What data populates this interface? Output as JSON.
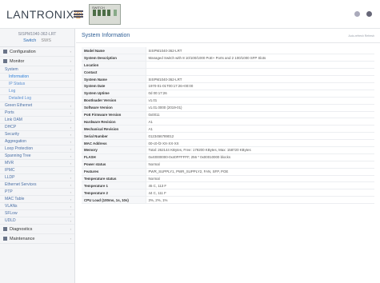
{
  "header": {
    "logo_text": "LANTRONIX",
    "logo_mark": "®",
    "switch_label": "SWITCH"
  },
  "sidebar": {
    "device_name": "SISPM1040-362-LRT",
    "save_label": "Switch",
    "save_extra": "SWS",
    "items": [
      {
        "label": "Configuration",
        "level": "top"
      },
      {
        "label": "Monitor",
        "level": "top"
      },
      {
        "label": "System",
        "level": "sub"
      },
      {
        "label": "Information",
        "level": "sub2",
        "active": true
      },
      {
        "label": "IP Status",
        "level": "sub2"
      },
      {
        "label": "Log",
        "level": "sub2"
      },
      {
        "label": "Detailed Log",
        "level": "sub2"
      },
      {
        "label": "Green Ethernet",
        "level": "sub"
      },
      {
        "label": "Ports",
        "level": "sub"
      },
      {
        "label": "Link OAM",
        "level": "sub"
      },
      {
        "label": "DHCP",
        "level": "sub"
      },
      {
        "label": "Security",
        "level": "sub"
      },
      {
        "label": "Aggregation",
        "level": "sub"
      },
      {
        "label": "Loop Protection",
        "level": "sub"
      },
      {
        "label": "Spanning Tree",
        "level": "sub"
      },
      {
        "label": "MVR",
        "level": "sub"
      },
      {
        "label": "IPMC",
        "level": "sub"
      },
      {
        "label": "LLDP",
        "level": "sub"
      },
      {
        "label": "Ethernet Services",
        "level": "sub"
      },
      {
        "label": "PTP",
        "level": "sub"
      },
      {
        "label": "MAC Table",
        "level": "sub"
      },
      {
        "label": "VLANs",
        "level": "sub"
      },
      {
        "label": "SFLow",
        "level": "sub"
      },
      {
        "label": "UDLD",
        "level": "sub"
      },
      {
        "label": "Diagnostics",
        "level": "top"
      },
      {
        "label": "Maintenance",
        "level": "top"
      }
    ]
  },
  "main": {
    "title": "System Information",
    "breadcrumb": "Auto-refresh  Refresh"
  },
  "info_rows": [
    {
      "key": "Model Name",
      "value": "SISPM1040-362-LRT"
    },
    {
      "key": "System Description",
      "value": "Managed Switch with 8 10/100/1000 PoE+ Ports and 2 100/1000 SFP Slots"
    },
    {
      "key": "Location",
      "value": ""
    },
    {
      "key": "Contact",
      "value": ""
    },
    {
      "key": "System Name",
      "value": "SISPM1040-362-LRT"
    },
    {
      "key": "System Date",
      "value": "1970-01-01T00:17:26+00:00"
    },
    {
      "key": "System Uptime",
      "value": "0d 00:17:26"
    },
    {
      "key": "Bootloader Version",
      "value": "v1.01"
    },
    {
      "key": "Software Version",
      "value": "v1.01.0000 (2019-01)"
    },
    {
      "key": "PoE Firmware Version",
      "value": "0x0011"
    },
    {
      "key": "Hardware Revision",
      "value": "A1"
    },
    {
      "key": "Mechanical Revision",
      "value": "A1"
    },
    {
      "key": "Serial Number",
      "value": "0123456789012"
    },
    {
      "key": "MAC Address",
      "value": "00-c0-f2-XX-XX-XX"
    },
    {
      "key": "Memory",
      "value": "Total: 262144 KBytes, Free: 179200 KBytes, Max: 158720 KBytes"
    },
    {
      "key": "FLASH",
      "value": "0x40000000-0x40FFFFFF, 256 * 0x00010000 blocks"
    },
    {
      "key": "Power status",
      "value": "Normal"
    },
    {
      "key": "Features",
      "value": "PWR_SUPPLY1, PWR_SUPPLY2, FAN, SFP, POE"
    },
    {
      "key": "Temperature status",
      "value": "Normal"
    },
    {
      "key": "Temperature 1",
      "value": "45 C, 113 F"
    },
    {
      "key": "Temperature 2",
      "value": "44 C, 111 F"
    },
    {
      "key": "CPU Load (100ms, 1s, 10s)",
      "value": "3%, 2%, 1%"
    }
  ]
}
